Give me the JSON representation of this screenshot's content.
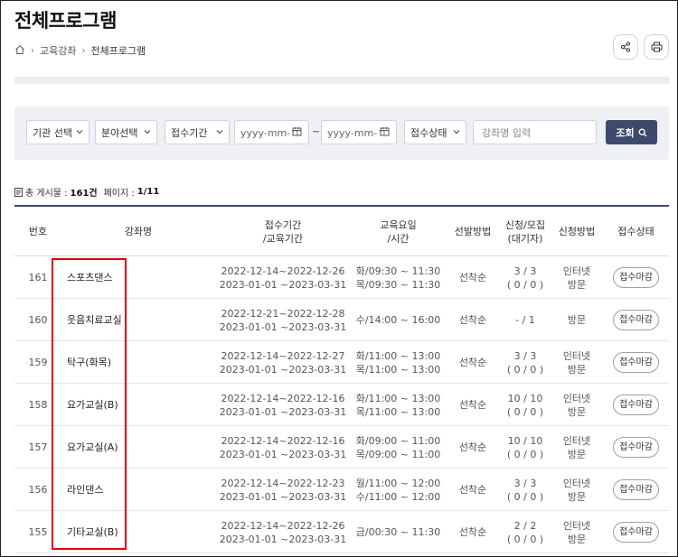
{
  "page": {
    "title": "전체프로그램"
  },
  "breadcrumb": {
    "home_icon": "home-icon",
    "items": [
      "교육강좌",
      "전체프로그램"
    ]
  },
  "actions": {
    "share_icon": "share-icon",
    "print_icon": "printer-icon"
  },
  "search": {
    "org_select": "기관 선택",
    "field_select": "분야선택",
    "period_select": "접수기간",
    "date_from_placeholder": "yyyy-mm-ㄱ",
    "tilde": "~",
    "date_to_placeholder": "yyyy-mm-ㄱ",
    "status_select": "접수상태",
    "keyword_placeholder": "강좌명 입력",
    "submit_label": "조회"
  },
  "summary": {
    "total_label": "총 게시물 :",
    "total_value": "161건",
    "page_label": "페이지 :",
    "page_value": "1/11"
  },
  "table": {
    "headers": {
      "no": "번호",
      "name": "강좌명",
      "period_line1": "접수기간",
      "period_line2": "/교육기간",
      "schedule_line1": "교육요일",
      "schedule_line2": "/시간",
      "selection": "선발방법",
      "apply_line1": "신청/모집",
      "apply_line2": "(대기자)",
      "method": "신청방법",
      "status": "접수상태"
    },
    "rows": [
      {
        "no": "161",
        "name": "스포츠댄스",
        "period1": "2022-12-14~2022-12-26",
        "period2": "2023-01-01 ~2023-03-31",
        "sched1": "화/09:30 ~ 11:30",
        "sched2": "목/09:30 ~ 11:30",
        "selection": "선착순",
        "apply1": "3 / 3",
        "apply2": "( 0 / 0 )",
        "method1": "인터넷",
        "method2": "방문",
        "status": "접수마감"
      },
      {
        "no": "160",
        "name": "웃음치료교실",
        "period1": "2022-12-21~2022-12-28",
        "period2": "2023-01-01 ~2023-03-31",
        "sched1": "수/14:00 ~ 16:00",
        "sched2": "",
        "selection": "선착순",
        "apply1": "- / 1",
        "apply2": "",
        "method1": "방문",
        "method2": "",
        "status": "접수마감"
      },
      {
        "no": "159",
        "name": "탁구(화목)",
        "period1": "2022-12-14~2022-12-27",
        "period2": "2023-01-01 ~2023-03-31",
        "sched1": "화/11:00 ~ 13:00",
        "sched2": "목/11:00 ~ 13:00",
        "selection": "선착순",
        "apply1": "3 / 3",
        "apply2": "( 0 / 0 )",
        "method1": "인터넷",
        "method2": "방문",
        "status": "접수마감"
      },
      {
        "no": "158",
        "name": "요가교실(B)",
        "period1": "2022-12-14~2022-12-16",
        "period2": "2023-01-01 ~2023-03-31",
        "sched1": "화/11:00 ~ 13:00",
        "sched2": "목/11:00 ~ 13:00",
        "selection": "선착순",
        "apply1": "10 / 10",
        "apply2": "( 0 / 0 )",
        "method1": "인터넷",
        "method2": "방문",
        "status": "접수마감"
      },
      {
        "no": "157",
        "name": "요가교실(A)",
        "period1": "2022-12-14~2022-12-16",
        "period2": "2023-01-01 ~2023-03-31",
        "sched1": "화/09:00 ~ 11:00",
        "sched2": "목/09:00 ~ 11:00",
        "selection": "선착순",
        "apply1": "10 / 10",
        "apply2": "( 0 / 0 )",
        "method1": "인터넷",
        "method2": "방문",
        "status": "접수마감"
      },
      {
        "no": "156",
        "name": "라인댄스",
        "period1": "2022-12-14~2022-12-23",
        "period2": "2023-01-01 ~2023-03-31",
        "sched1": "월/11:00 ~ 12:00",
        "sched2": "수/11:00 ~ 12:00",
        "selection": "선착순",
        "apply1": "3 / 3",
        "apply2": "( 0 / 0 )",
        "method1": "인터넷",
        "method2": "방문",
        "status": "접수마감"
      },
      {
        "no": "155",
        "name": "기타교실(B)",
        "period1": "2022-12-14~2022-12-26",
        "period2": "2023-01-01 ~2023-03-31",
        "sched1": "금/00:30 ~ 11:30",
        "sched2": "",
        "selection": "선착순",
        "apply1": "2 / 2",
        "apply2": "( 0 / 0 )",
        "method1": "인터넷",
        "method2": "방문",
        "status": "접수마감"
      }
    ]
  },
  "colors": {
    "accent": "#3d4a6b",
    "highlight": "#e00000",
    "panel": "#eef0f5"
  }
}
